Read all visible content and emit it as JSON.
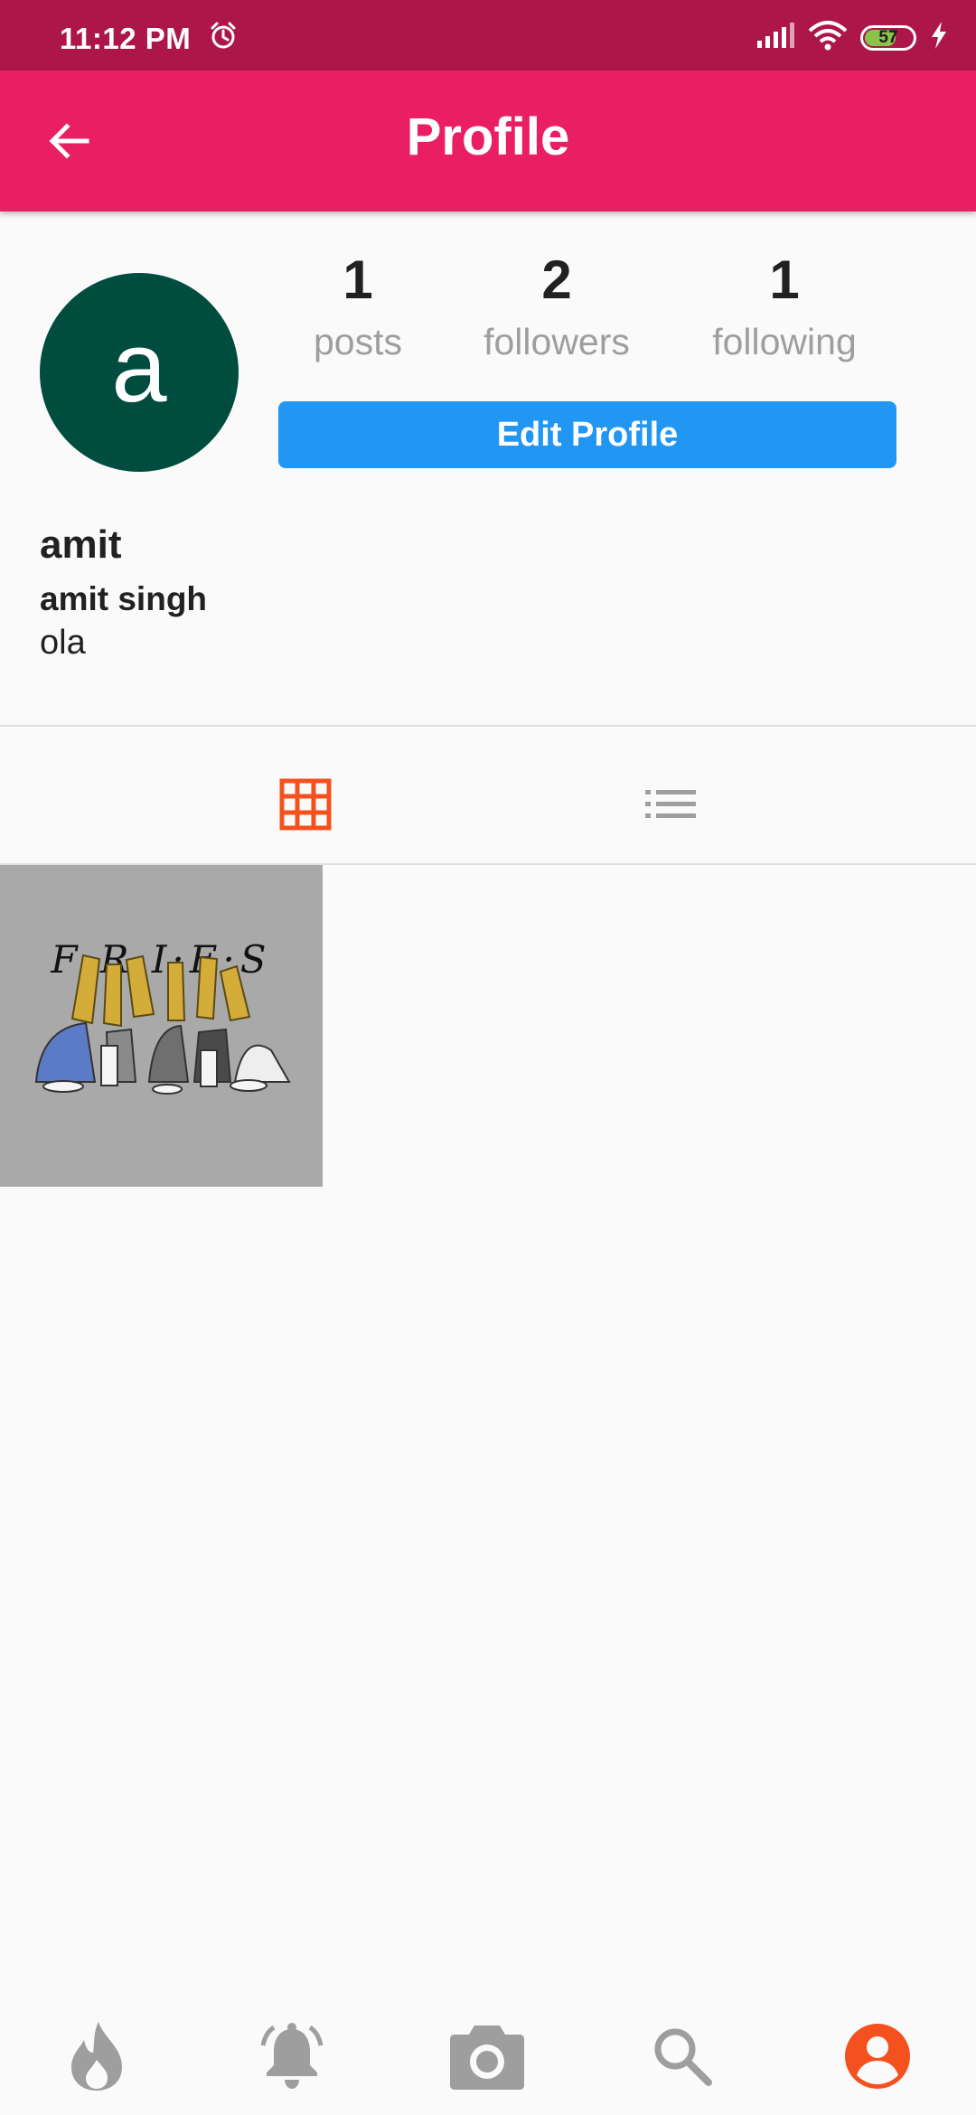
{
  "status_bar": {
    "time": "11:12 PM",
    "battery_level": "57",
    "icons": [
      "alarm-icon",
      "signal-icon",
      "wifi-icon",
      "battery-icon",
      "charging-icon"
    ]
  },
  "app_bar": {
    "title": "Profile",
    "back_icon": "arrow-back-icon"
  },
  "profile": {
    "avatar_letter": "a",
    "avatar_color": "#004d40",
    "username": "amit",
    "full_name": "amit singh",
    "bio": "ola",
    "edit_button_label": "Edit Profile"
  },
  "stats": [
    {
      "value": "1",
      "label": "posts"
    },
    {
      "value": "2",
      "label": "followers"
    },
    {
      "value": "1",
      "label": "following"
    }
  ],
  "tabs": [
    {
      "icon": "grid-icon",
      "active": true
    },
    {
      "icon": "list-icon",
      "active": false
    }
  ],
  "posts": [
    {
      "caption_art_text": "F·R·I·E·S"
    }
  ],
  "bottom_nav": [
    {
      "icon": "fire-icon",
      "active": false
    },
    {
      "icon": "bell-icon",
      "active": false
    },
    {
      "icon": "camera-icon",
      "active": false
    },
    {
      "icon": "search-icon",
      "active": false
    },
    {
      "icon": "account-icon",
      "active": true
    }
  ],
  "colors": {
    "status_bar": "#ad1649",
    "app_bar": "#e91e63",
    "primary_button": "#2196f3",
    "active_accent": "#f4511e",
    "inactive_icon": "#9e9e9e"
  }
}
